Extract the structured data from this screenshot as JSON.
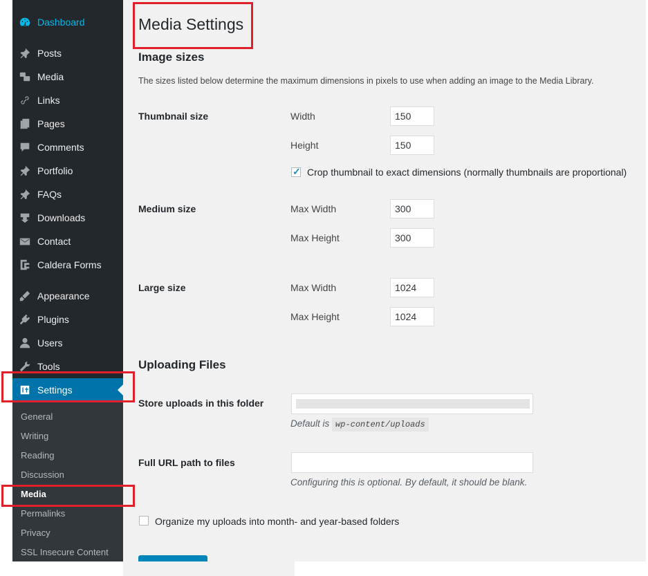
{
  "sidebar": {
    "dashboard_label": "Dashboard",
    "items": [
      {
        "label": "Posts",
        "icon": "pin-icon"
      },
      {
        "label": "Media",
        "icon": "media-icon"
      },
      {
        "label": "Links",
        "icon": "link-icon"
      },
      {
        "label": "Pages",
        "icon": "pages-icon"
      },
      {
        "label": "Comments",
        "icon": "comment-icon"
      },
      {
        "label": "Portfolio",
        "icon": "pin-icon"
      },
      {
        "label": "FAQs",
        "icon": "pin-icon"
      },
      {
        "label": "Downloads",
        "icon": "download-icon"
      },
      {
        "label": "Contact",
        "icon": "mail-icon"
      },
      {
        "label": "Caldera Forms",
        "icon": "caldera-icon"
      },
      {
        "label": "Appearance",
        "icon": "brush-icon"
      },
      {
        "label": "Plugins",
        "icon": "plugin-icon"
      },
      {
        "label": "Users",
        "icon": "user-icon"
      },
      {
        "label": "Tools",
        "icon": "wrench-icon"
      },
      {
        "label": "Settings",
        "icon": "settings-icon"
      }
    ],
    "submenu": [
      "General",
      "Writing",
      "Reading",
      "Discussion",
      "Media",
      "Permalinks",
      "Privacy",
      "SSL Insecure Content"
    ],
    "active_color": "#0073aa"
  },
  "main": {
    "title": "Media Settings",
    "image_sizes": {
      "heading": "Image sizes",
      "description": "The sizes listed below determine the maximum dimensions in pixels to use when adding an image to the Media Library.",
      "thumbnail": {
        "label": "Thumbnail size",
        "width_label": "Width",
        "width": "150",
        "height_label": "Height",
        "height": "150",
        "crop_label": "Crop thumbnail to exact dimensions (normally thumbnails are proportional)",
        "crop_checked": true
      },
      "medium": {
        "label": "Medium size",
        "width_label": "Max Width",
        "width": "300",
        "height_label": "Max Height",
        "height": "300"
      },
      "large": {
        "label": "Large size",
        "width_label": "Max Width",
        "width": "1024",
        "height_label": "Max Height",
        "height": "1024"
      }
    },
    "uploading": {
      "heading": "Uploading Files",
      "store_label": "Store uploads in this folder",
      "store_hint_prefix": "Default is",
      "store_hint_code": "wp-content/uploads",
      "url_label": "Full URL path to files",
      "url_hint": "Configuring this is optional. By default, it should be blank.",
      "organize_label": "Organize my uploads into month- and year-based folders",
      "organize_checked": false
    }
  }
}
